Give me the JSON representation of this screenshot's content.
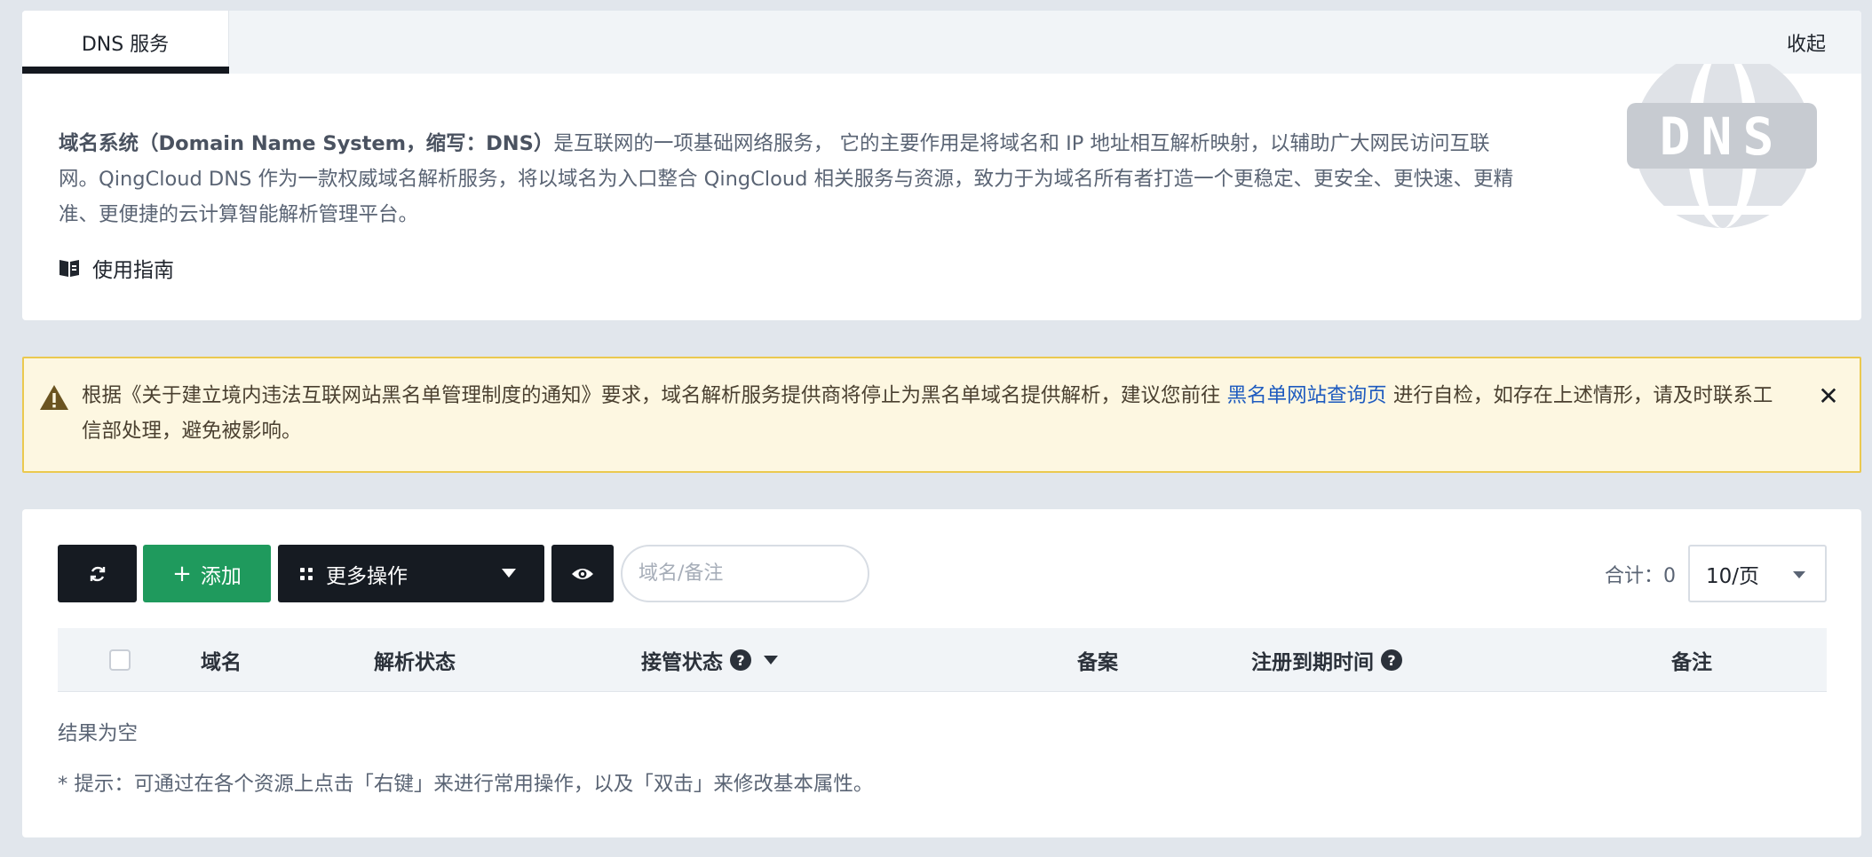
{
  "intro": {
    "tab_label": "DNS 服务",
    "collapse_label": "收起",
    "desc_bold": "域名系统（Domain Name System，缩写：DNS）",
    "desc_rest": "是互联网的一项基础网络服务， 它的主要作用是将域名和 IP 地址相互解析映射，以辅助广大网民访问互联网。QingCloud DNS 作为一款权威域名解析服务，将以域名为入口整合 QingCloud 相关服务与资源，致力于为域名所有者打造一个更稳定、更安全、更快速、更精准、更便捷的云计算智能解析管理平台。",
    "guide_label": "使用指南",
    "logo_text": "DNS",
    "logo_icon": "dns-globe-icon",
    "guide_icon": "book-icon"
  },
  "notice": {
    "text_before": "根据《关于建立境内违法互联网站黑名单管理制度的通知》要求，域名解析服务提供商将停止为黑名单域名提供解析，建议您前往 ",
    "link_text": "黑名单网站查询页",
    "text_after": " 进行自检，如存在上述情形，请及时联系工信部处理，避免被影响。",
    "close_symbol": "✕",
    "icon": "warning-icon",
    "bg_color": "#fdf7e1",
    "border_color": "#ebc94f"
  },
  "toolbar": {
    "add_label": "添加",
    "more_label": "更多操作",
    "search_placeholder": "域名/备注",
    "total_label": "合计：0",
    "page_size": "10/页",
    "add_color": "#1f9a5d",
    "dark_color": "#161b22"
  },
  "table": {
    "columns": [
      "域名",
      "解析状态",
      "接管状态",
      "备案",
      "注册到期时间",
      "备注"
    ],
    "help_symbol": "?",
    "empty_text": "结果为空",
    "hint_text": "* 提示：可通过在各个资源上点击「右键」来进行常用操作，以及「双击」来修改基本属性。"
  }
}
